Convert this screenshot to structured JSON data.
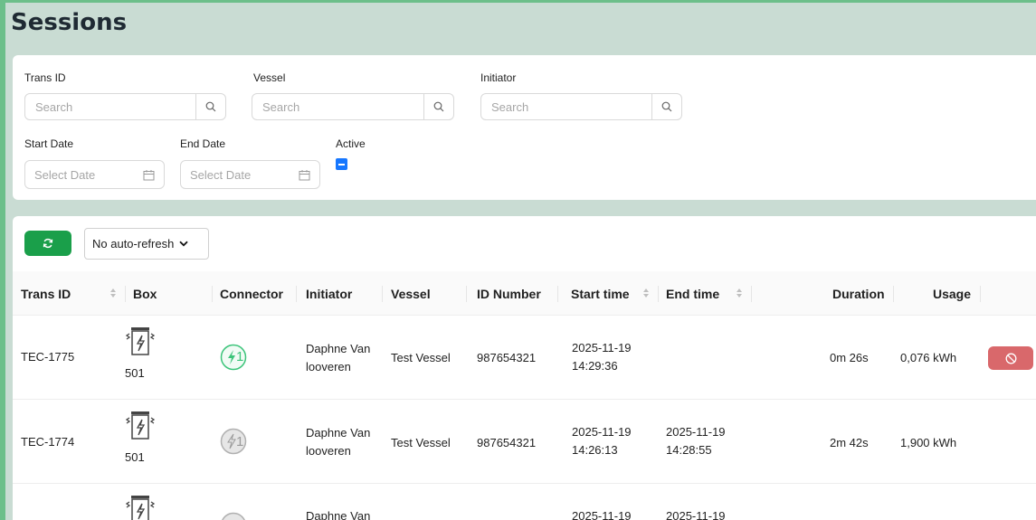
{
  "page": {
    "title": "Sessions"
  },
  "filters": {
    "trans_id": {
      "label": "Trans ID",
      "placeholder": "Search"
    },
    "vessel": {
      "label": "Vessel",
      "placeholder": "Search"
    },
    "initiator": {
      "label": "Initiator",
      "placeholder": "Search"
    },
    "start_date": {
      "label": "Start Date",
      "placeholder": "Select Date"
    },
    "end_date": {
      "label": "End Date",
      "placeholder": "Select Date"
    },
    "active": {
      "label": "Active",
      "state": "indeterminate"
    }
  },
  "toolbar": {
    "refresh_icon": "refresh-icon",
    "auto_refresh_value": "No auto-refresh"
  },
  "table": {
    "columns": {
      "trans_id": "Trans ID",
      "box": "Box",
      "connector": "Connector",
      "initiator": "Initiator",
      "vessel": "Vessel",
      "id_number": "ID Number",
      "start_time": "Start time",
      "end_time": "End time",
      "duration": "Duration",
      "usage": "Usage"
    },
    "rows": [
      {
        "trans_id": "TEC-1775",
        "box": "501",
        "connector": "1",
        "connector_active": true,
        "initiator_line1": "Daphne Van",
        "initiator_line2": "looveren",
        "vessel": "Test Vessel",
        "id_number": "987654321",
        "start_date": "2025-11-19",
        "start_clock": "14:29:36",
        "end_date": "",
        "end_clock": "",
        "duration": "0m 26s",
        "usage": "0,076 kWh",
        "has_stop": true
      },
      {
        "trans_id": "TEC-1774",
        "box": "501",
        "connector": "1",
        "connector_active": false,
        "initiator_line1": "Daphne Van",
        "initiator_line2": "looveren",
        "vessel": "Test Vessel",
        "id_number": "987654321",
        "start_date": "2025-11-19",
        "start_clock": "14:26:13",
        "end_date": "2025-11-19",
        "end_clock": "14:28:55",
        "duration": "2m 42s",
        "usage": "1,900 kWh",
        "has_stop": false
      },
      {
        "trans_id": "",
        "box": "",
        "connector": "",
        "connector_active": false,
        "initiator_line1": "Daphne Van",
        "initiator_line2": "",
        "vessel": "",
        "id_number": "",
        "start_date": "2025-11-19",
        "start_clock": "",
        "end_date": "2025-11-19",
        "end_clock": "",
        "duration": "",
        "usage": "",
        "has_stop": false
      }
    ]
  },
  "colors": {
    "accent_green": "#1a9f4a",
    "connector_active": "#3cc47a",
    "connector_inactive": "#9a9a9a",
    "stop_red": "#d9686b",
    "checkbox_blue": "#1677ff"
  }
}
